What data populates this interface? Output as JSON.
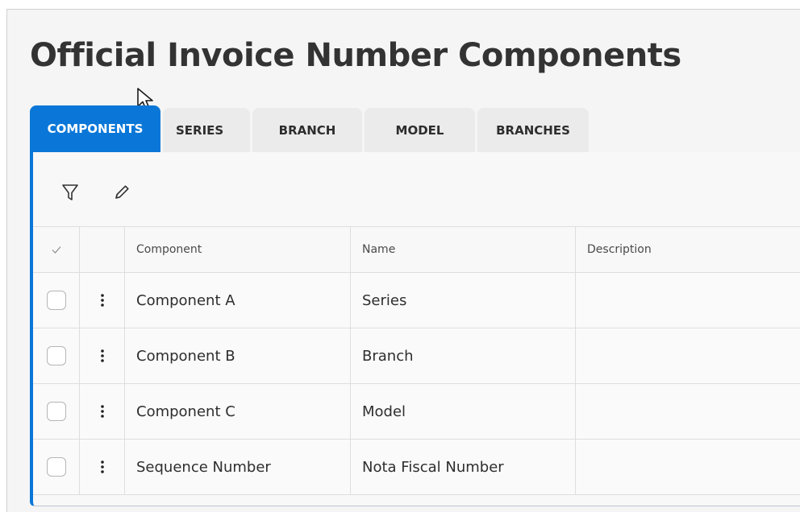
{
  "page": {
    "title": "Official Invoice Number Components"
  },
  "tabs": [
    {
      "label": "COMPONENTS",
      "active": true
    },
    {
      "label": "SERIES",
      "active": false
    },
    {
      "label": "BRANCH",
      "active": false
    },
    {
      "label": "MODEL",
      "active": false
    },
    {
      "label": "BRANCHES",
      "active": false
    }
  ],
  "toolbar": {
    "filter_icon": "filter-icon",
    "edit_icon": "pencil-icon"
  },
  "grid": {
    "select_all_icon": "check-icon",
    "columns": {
      "component": "Component",
      "name": "Name",
      "description": "Description"
    },
    "rows": [
      {
        "component": "Component A",
        "name": "Series",
        "description": ""
      },
      {
        "component": "Component B",
        "name": "Branch",
        "description": ""
      },
      {
        "component": "Component C",
        "name": "Model",
        "description": ""
      },
      {
        "component": "Sequence Number",
        "name": "Nota Fiscal Number",
        "description": ""
      }
    ]
  },
  "colors": {
    "accent": "#0a77d8",
    "tab_inactive": "#ebebeb",
    "title_text": "#333333"
  }
}
